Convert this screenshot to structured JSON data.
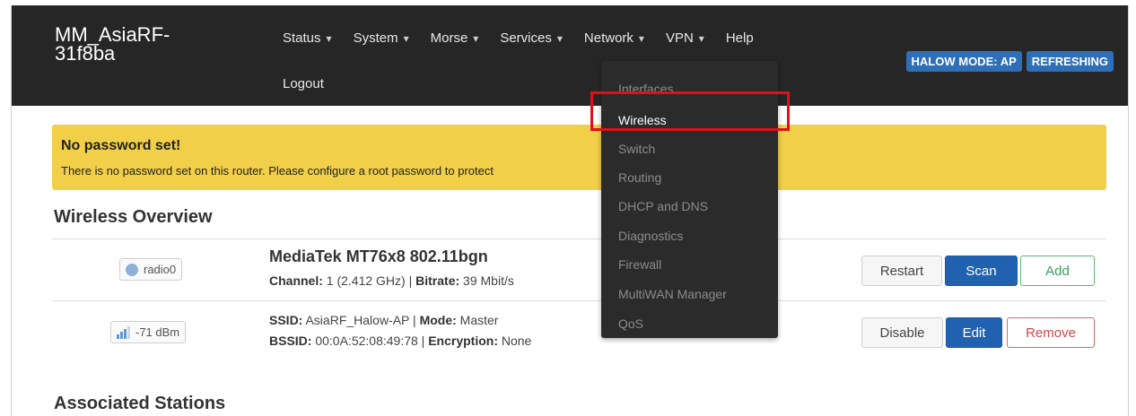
{
  "brand": "MM_AsiaRF-31f8ba",
  "nav": {
    "items": [
      {
        "label": "Status",
        "caret": "▾"
      },
      {
        "label": "System",
        "caret": "▾"
      },
      {
        "label": "Morse",
        "caret": "▾"
      },
      {
        "label": "Services",
        "caret": "▾"
      },
      {
        "label": "Network",
        "caret": "▾"
      },
      {
        "label": "VPN",
        "caret": "▾"
      },
      {
        "label": "Help",
        "caret": ""
      }
    ],
    "logout": "Logout"
  },
  "badges": {
    "mode": "HALOW MODE: AP",
    "status": "REFRESHING",
    "color": "#2f6fb8"
  },
  "alert": {
    "title": "No password set!",
    "text": "There is no password set on this router. Please configure a root password to protect",
    "color": "#f1cf49"
  },
  "wireless_overview": {
    "title": "Wireless Overview",
    "radio": {
      "name": "radio0",
      "device": "MediaTek MT76x8 802.11bgn",
      "channel_label": "Channel:",
      "channel_value": "1 (2.412 GHz)",
      "bitrate_label": "Bitrate:",
      "bitrate_value": "39 Mbit/s",
      "buttons": {
        "restart": "Restart",
        "scan": "Scan",
        "add": "Add"
      }
    },
    "network": {
      "signal": "-71 dBm",
      "ssid_label": "SSID:",
      "ssid_value": "AsiaRF_Halow-AP",
      "mode_label": "Mode:",
      "mode_value": "Master",
      "bssid_label": "BSSID:",
      "bssid_value": "00:0A:52:08:49:78",
      "encryption_label": "Encryption:",
      "encryption_value": "None",
      "buttons": {
        "disable": "Disable",
        "edit": "Edit",
        "remove": "Remove"
      }
    }
  },
  "associated_stations": {
    "title": "Associated Stations"
  },
  "network_menu": {
    "items": [
      {
        "label": "Interfaces"
      },
      {
        "label": "Wireless",
        "active": true
      },
      {
        "label": "Switch"
      },
      {
        "label": "Routing"
      },
      {
        "label": "DHCP and DNS"
      },
      {
        "label": "Diagnostics"
      },
      {
        "label": "Firewall"
      },
      {
        "label": "MultiWAN Manager"
      },
      {
        "label": "QoS"
      }
    ]
  },
  "colors": {
    "header_bg": "#262626",
    "primary": "#2162b0",
    "highlight": "#e0101a"
  }
}
